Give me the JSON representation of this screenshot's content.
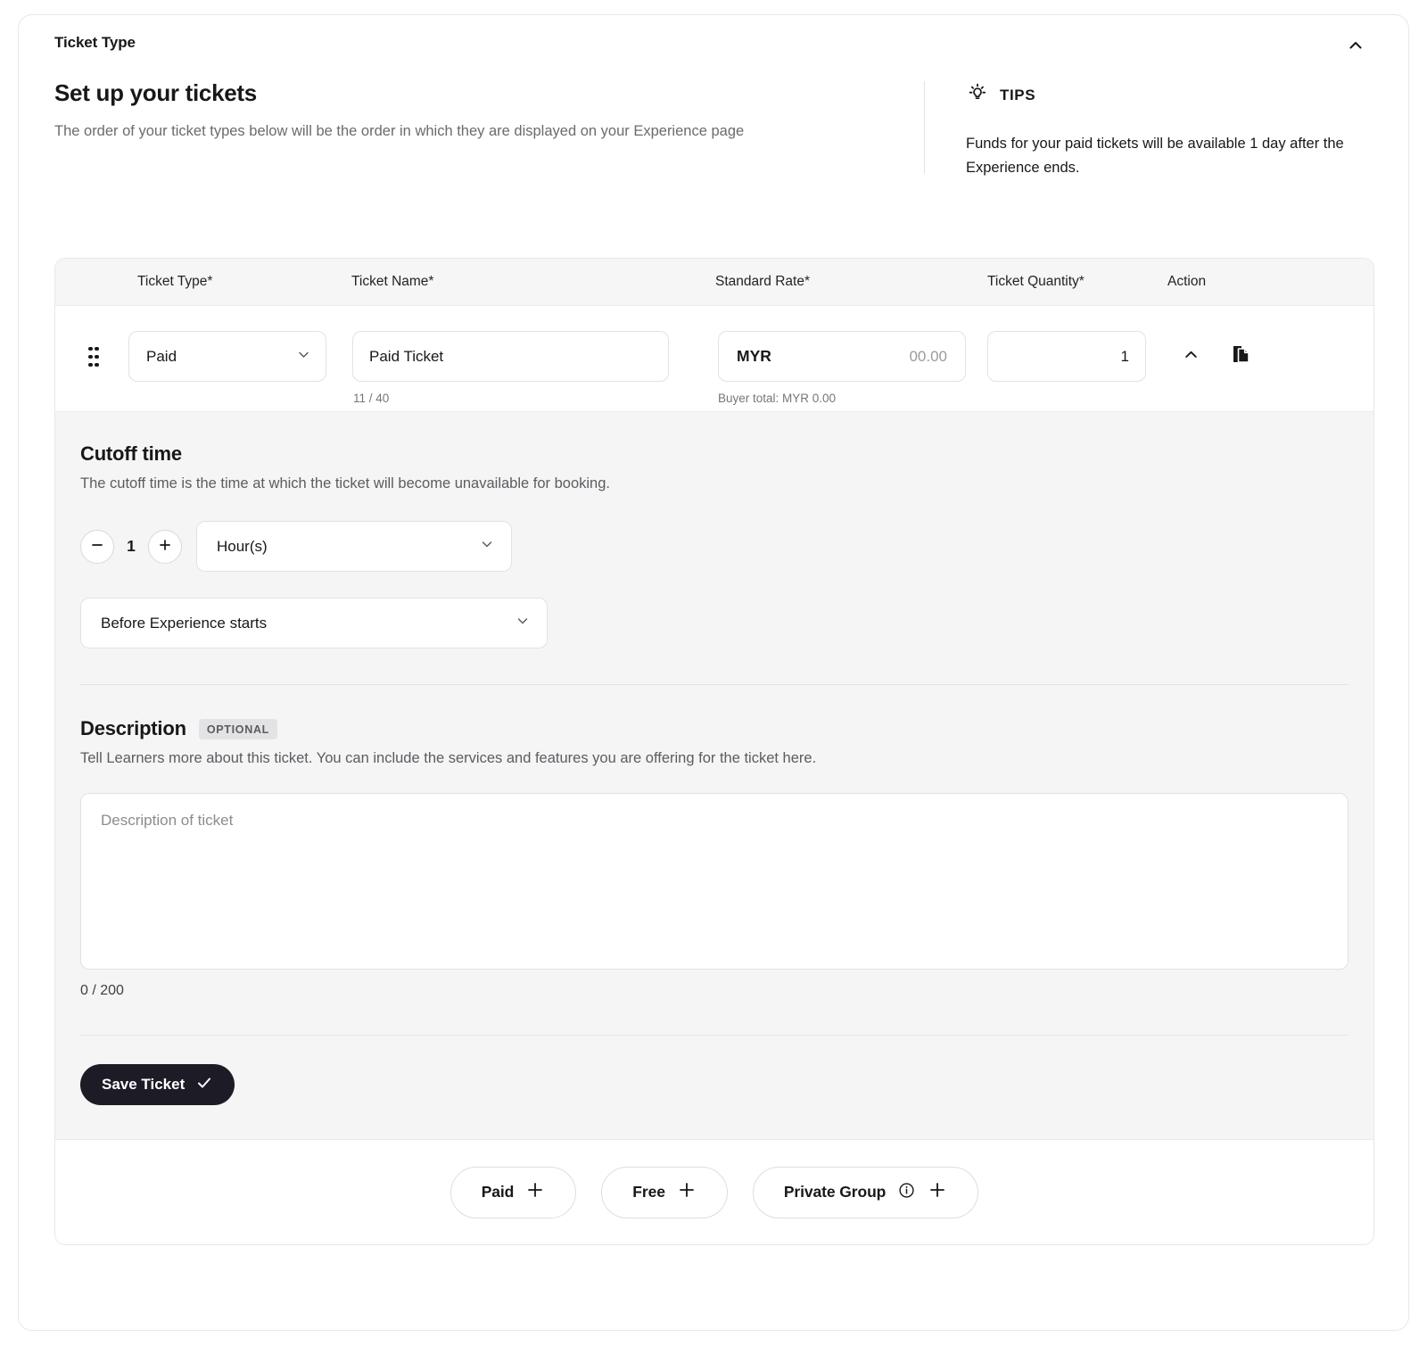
{
  "section": {
    "header_title": "Ticket Type",
    "collapse_icon": "chevron-up-icon"
  },
  "intro": {
    "title": "Set up your tickets",
    "subtitle": "The order of your ticket types below will be the order in which they are displayed on your Experience page"
  },
  "tips": {
    "icon": "lightbulb-icon",
    "label": "TIPS",
    "body": "Funds for your paid tickets will be available 1 day after the Experience ends."
  },
  "table": {
    "columns": {
      "ticket_type": "Ticket Type*",
      "ticket_name": "Ticket Name*",
      "standard_rate": "Standard Rate*",
      "ticket_quantity": "Ticket Quantity*",
      "action": "Action"
    },
    "row": {
      "drag_handle_icon": "drag-handle-icon",
      "ticket_type_value": "Paid",
      "ticket_name_value": "Paid Ticket",
      "ticket_name_counter": "11 / 40",
      "currency": "MYR",
      "rate_placeholder": "00.00",
      "buyer_total": "Buyer total:  MYR 0.00",
      "quantity_value": "1",
      "collapse_icon": "chevron-up-icon",
      "duplicate_icon": "duplicate-icon"
    }
  },
  "cutoff": {
    "title": "Cutoff time",
    "description": "The cutoff time is the time at which the ticket will become unavailable for booking.",
    "decrement_label": "minus-icon",
    "increment_label": "plus-icon",
    "value": "1",
    "unit": "Hour(s)",
    "relation": "Before Experience starts"
  },
  "description": {
    "title": "Description",
    "badge": "OPTIONAL",
    "helper": "Tell Learners more about this ticket. You can include the services and features you are offering for the ticket here.",
    "placeholder": "Description of ticket",
    "value": "",
    "counter": "0 / 200"
  },
  "actions": {
    "save_label": "Save Ticket",
    "save_icon": "check-icon",
    "add_paid": "Paid",
    "add_free": "Free",
    "add_private_group": "Private Group",
    "info_icon": "info-icon",
    "plus_icon": "plus-icon"
  },
  "colors": {
    "accent_dark": "#1d1b26",
    "panel_gray": "#f5f5f6",
    "border": "#e2e2e4",
    "muted_text": "#6b6b70"
  }
}
